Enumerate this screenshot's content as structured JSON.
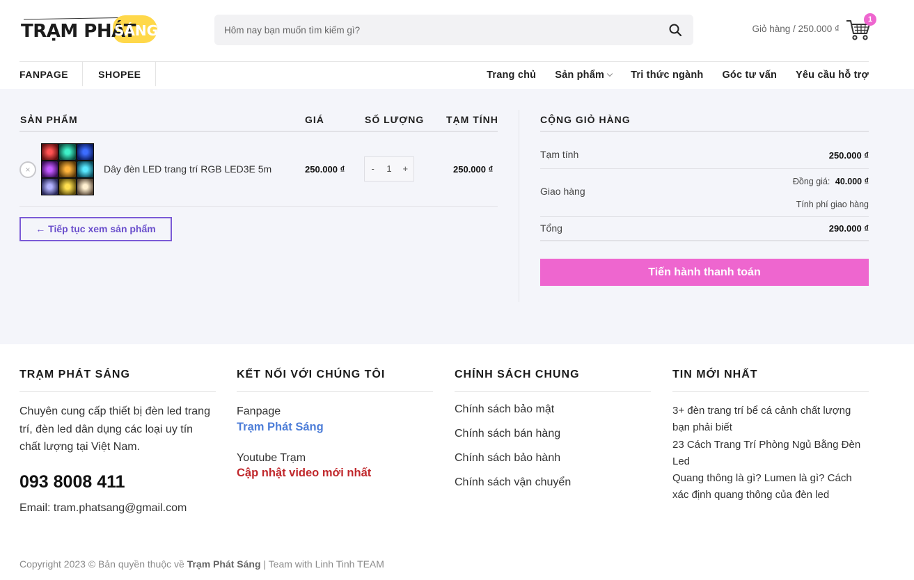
{
  "header": {
    "logo_text": "TRẠM PHÁT",
    "logo_highlight": "SÁNG",
    "search_placeholder": "Hôm nay bạn muốn tìm kiếm gì?",
    "cart_label": "Giỏ hàng / 250.000 ₫",
    "cart_count": "1",
    "brand_color": "#ee66cf"
  },
  "nav": {
    "left": [
      "FANPAGE",
      "SHOPEE"
    ],
    "right": [
      "Trang chủ",
      "Sản phẩm",
      "Tri thức ngành",
      "Góc tư vấn",
      "Yêu cầu hỗ trợ"
    ]
  },
  "cart_table": {
    "headers": {
      "product": "SẢN PHẨM",
      "price": "GIÁ",
      "qty": "SỐ LƯỢNG",
      "subtotal": "TẠM TÍNH"
    },
    "item": {
      "remove": "×",
      "name": "Dây đèn LED trang trí RGB LED3E 5m",
      "price": "250.000 ₫",
      "minus": "-",
      "qty": "1",
      "plus": "+",
      "subtotal": "250.000 ₫"
    },
    "continue_label": "← Tiếp tục xem sản phẩm"
  },
  "cart_totals": {
    "title": "CỘNG GIỎ HÀNG",
    "subtotal_label": "Tạm tính",
    "subtotal_value": "250.000 ₫",
    "shipping_label": "Giao hàng",
    "shipping_flat_label": "Đồng giá:",
    "shipping_flat_value": "40.000 ₫",
    "shipping_calc": "Tính phí giao hàng",
    "total_label": "Tổng",
    "total_value": "290.000 ₫",
    "checkout_label": "Tiến hành thanh toán"
  },
  "footer": {
    "col1": {
      "title": "TRẠM PHÁT SÁNG",
      "desc": "Chuyên cung cấp thiết bị đèn led trang trí, đèn led dân dụng các loại uy tín chất lượng tại Việt Nam.",
      "phone": "093 8008 411",
      "email": "Email: tram.phatsang@gmail.com"
    },
    "col2": {
      "title": "KẾT NỐI VỚI CHÚNG TÔI",
      "fanpage_label": "Fanpage",
      "fanpage_link": "Trạm Phát Sáng",
      "youtube_label": "Youtube Trạm",
      "youtube_link": "Cập nhật video mới nhất"
    },
    "col3": {
      "title": "CHÍNH SÁCH CHUNG",
      "items": [
        "Chính sách bảo mật",
        "Chính sách bán hàng",
        "Chính sách bảo hành",
        "Chính sách vận chuyển"
      ]
    },
    "col4": {
      "title": "TIN MỚI NHẤT",
      "items": [
        "3+ đèn trang trí bể cá cảnh chất lượng bạn phải biết",
        "23 Cách Trang Trí Phòng Ngủ Bằng Đèn Led",
        "Quang thông là gì? Lumen là gì? Cách xác định quang thông của đèn led"
      ]
    },
    "copyright_prefix": "Copyright 2023 © Bản quyền thuộc về",
    "copyright_brand": "Trạm Phát Sáng",
    "copyright_suffix": "| Team with Linh Tinh TEAM"
  }
}
